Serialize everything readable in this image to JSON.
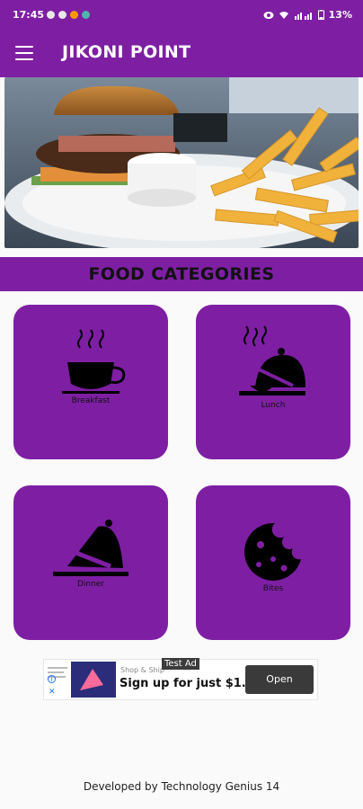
{
  "status_bar": {
    "time": "17:45",
    "battery": "13%",
    "notification_colors": [
      "#e8e8e8",
      "#ff9800",
      "#f4b400",
      "#4db6ac"
    ]
  },
  "app": {
    "title": "JIKONI POINT",
    "accent": "#7e1fa3"
  },
  "section": {
    "title": "FOOD CATEGORIES"
  },
  "categories": [
    {
      "label": "Breakfast",
      "icon": "teacup-icon"
    },
    {
      "label": "Lunch",
      "icon": "covered-dish-icon"
    },
    {
      "label": "Dinner",
      "icon": "cloche-icon"
    },
    {
      "label": "Bites",
      "icon": "cookie-icon"
    }
  ],
  "ad": {
    "badge": "Test Ad",
    "small_text": "Shop & Ship",
    "headline": "Sign up for just $1.",
    "cta": "Open"
  },
  "footer": {
    "text": "Developed by Technology Genius 14"
  }
}
